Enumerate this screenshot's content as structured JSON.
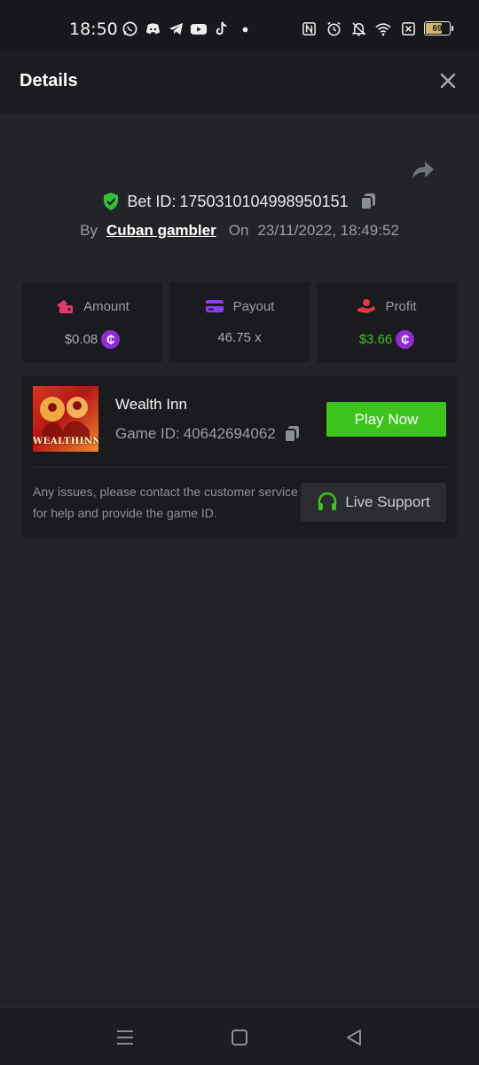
{
  "status_bar": {
    "time": "18:50",
    "battery": "69",
    "left_icons": [
      "whatsapp-icon",
      "discord-icon",
      "telegram-icon",
      "youtube-icon",
      "tiktok-icon",
      "dot-icon"
    ],
    "right_icons": [
      "nfc-icon",
      "alarm-icon",
      "mute-icon",
      "wifi-icon",
      "sim-icon",
      "battery-icon"
    ]
  },
  "header": {
    "title": "Details",
    "close_icon": "close-icon"
  },
  "bet": {
    "label": "Bet ID:",
    "id": "1750310104998950151",
    "by_label": "By",
    "user": "Cuban gambler",
    "on_label": "On",
    "datetime": "23/11/2022, 18:49:52"
  },
  "stats": [
    {
      "label": "Amount",
      "value": "$0.08",
      "icon": "amount-icon",
      "has_coin": true,
      "value_color": "#a8aab0"
    },
    {
      "label": "Payout",
      "value": "46.75 x",
      "icon": "payout-card-icon",
      "has_coin": false,
      "value_color": "#a8aab0"
    },
    {
      "label": "Profit",
      "value": "$3.66",
      "icon": "profit-hand-icon",
      "has_coin": true,
      "value_color": "#3cc41d"
    }
  ],
  "coin_symbol": "₵",
  "game": {
    "name": "Wealth Inn",
    "id_label": "Game ID:",
    "id": "40642694062",
    "thumb_text": "WEALTHINN",
    "play_label": "Play Now",
    "help_text": "Any issues, please contact the customer service for help and provide the game ID.",
    "support_label": "Live Support"
  },
  "colors": {
    "accent_green": "#3cc41d",
    "coin_purple": "#8f2cd6",
    "shield_green": "#2fbf3a",
    "amount_pink": "#e8376c",
    "payout_purple": "#8b3df0",
    "profit_red": "#e0393e"
  }
}
